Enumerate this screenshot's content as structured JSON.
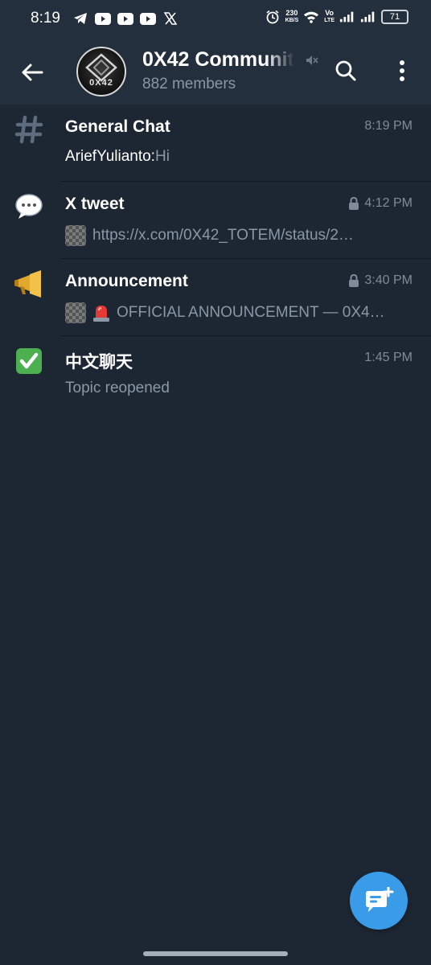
{
  "status_bar": {
    "time": "8:19",
    "net_speed_value": "230",
    "net_speed_unit": "KB/S",
    "volte_top": "Vo",
    "volte_bottom": "LTE",
    "battery": "71"
  },
  "header": {
    "title": "0X42 Communit",
    "subtitle": "882 members",
    "avatar_text": "0X42"
  },
  "topics": [
    {
      "name": "General Chat",
      "time": "8:19 PM",
      "sender": "AriefYulianto: ",
      "preview": "Hi",
      "icon": "hashtag-icon",
      "locked": false
    },
    {
      "name": "X tweet",
      "time": "4:12 PM",
      "preview": "https://x.com/0X42_TOTEM/status/2…",
      "icon": "speech-bubble-icon",
      "locked": true
    },
    {
      "name": "Announcement",
      "time": "3:40 PM",
      "preview": "OFFICIAL ANNOUNCEMENT — 0X4…",
      "icon": "megaphone-icon",
      "locked": true
    },
    {
      "name": "中文聊天",
      "time": "1:45 PM",
      "preview": "Topic reopened",
      "icon": "check-mark-icon",
      "locked": false
    }
  ],
  "colors": {
    "background": "#1d2733",
    "header": "#242f3d",
    "accent": "#3a9be8",
    "muted_text": "#8a97a5"
  }
}
